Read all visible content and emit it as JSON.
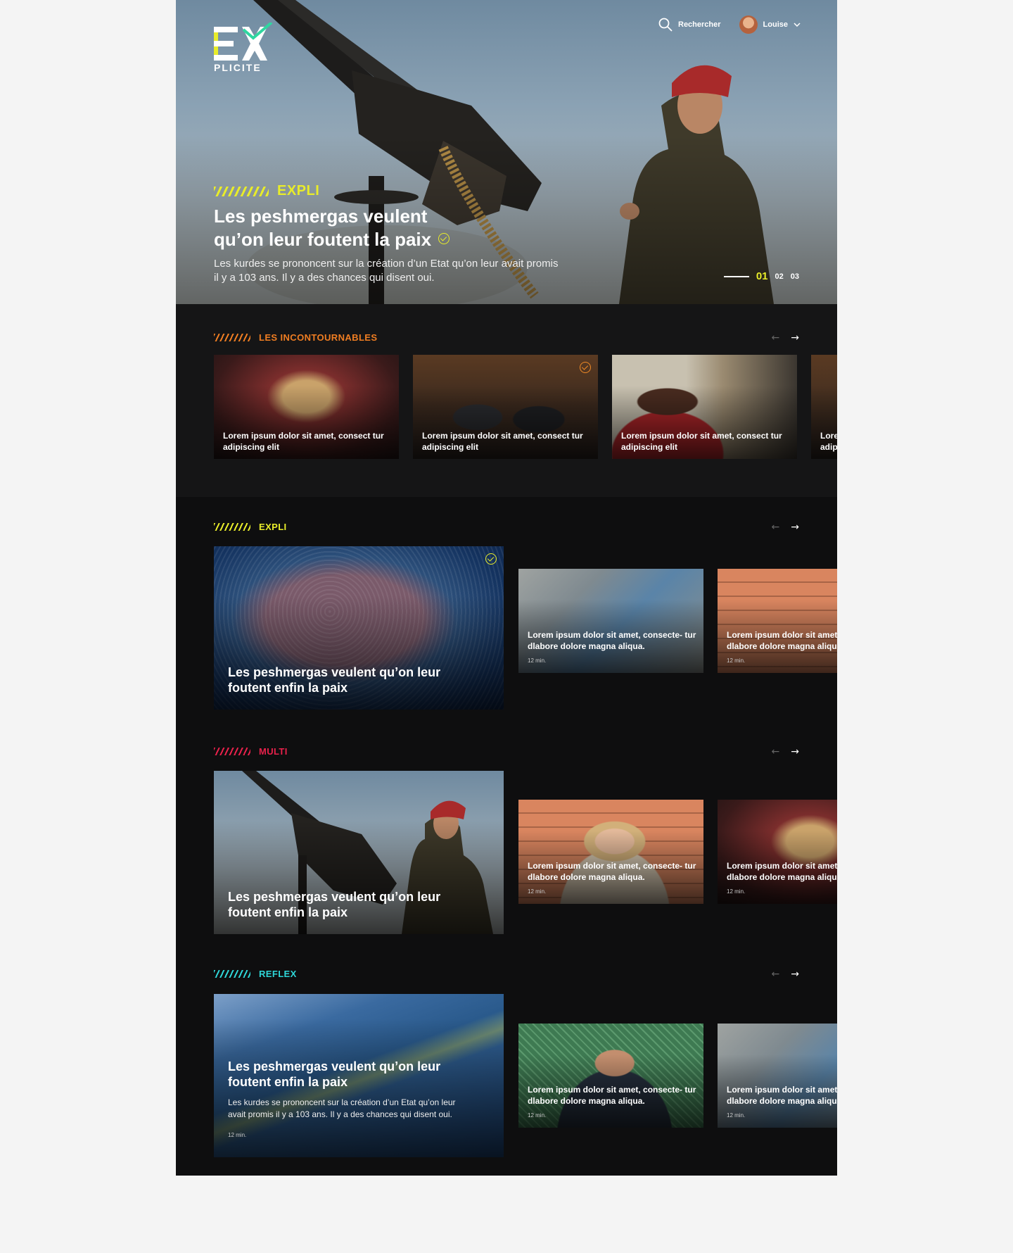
{
  "header": {
    "brand_top": "EX",
    "brand_bottom": "PLICITE",
    "search_label": "Rechercher",
    "user_name": "Louise"
  },
  "hero": {
    "tag": "EXPLI",
    "title_line1": "Les peshmergas veulent",
    "title_line2": "qu’on leur foutent la paix",
    "description": "Les kurdes se prononcent sur la création d’un Etat qu’on leur avait promis il y a 103 ans. Il y a des chances qui disent oui.",
    "pager": [
      "01",
      "02",
      "03"
    ],
    "pager_active": 0
  },
  "colors": {
    "expli": "#e8ec2a",
    "incontournables": "#ef7d22",
    "multi": "#e8214b",
    "reflex": "#2fd6d8"
  },
  "sections": {
    "incontournables": {
      "label": "LES INCONTOURNABLES",
      "cards": [
        {
          "caption": "Lorem ipsum dolor sit amet, consect tur adipiscing elit"
        },
        {
          "caption": "Lorem ipsum dolor sit amet, consect tur adipiscing elit"
        },
        {
          "caption": "Lorem ipsum dolor sit amet, consect tur adipiscing elit"
        },
        {
          "caption": "Lorem ipsum dolor sit amet, consect tur adipiscing elit"
        }
      ]
    },
    "expli": {
      "label": "EXPLI",
      "feature_title": "Les peshmergas veulent qu’on leur foutent enfin la paix",
      "cards": [
        {
          "caption": "Lorem ipsum dolor sit amet, consecte- tur dlabore dolore magna aliqua.",
          "duration": "12 min."
        },
        {
          "caption": "Lorem ipsum dolor sit amet, consecte- tur dlabore dolore magna aliqua.",
          "duration": "12 min."
        }
      ]
    },
    "multi": {
      "label": "MULTI",
      "feature_title": "Les peshmergas veulent qu’on leur foutent enfin la paix",
      "cards": [
        {
          "caption": "Lorem ipsum dolor sit amet, consecte- tur dlabore dolore magna aliqua.",
          "duration": "12 min."
        },
        {
          "caption": "Lorem ipsum dolor sit amet, consecte- tur dlabore dolore magna aliqua.",
          "duration": "12 min."
        }
      ]
    },
    "reflex": {
      "label": "REFLEX",
      "feature_title": "Les peshmergas veulent qu’on leur foutent enfin la paix",
      "feature_desc": "Les kurdes se prononcent sur la création d’un Etat qu’on leur avait promis il y a 103 ans. Il y a des chances qui disent oui.",
      "feature_duration": "12 min.",
      "cards": [
        {
          "caption": "Lorem ipsum dolor sit amet, consecte- tur dlabore dolore magna aliqua.",
          "duration": "12 min."
        },
        {
          "caption": "Lorem ipsum dolor sit amet, consecte- tur dlabore dolore magna aliqua.",
          "duration": "12 min."
        }
      ]
    }
  },
  "nav": {
    "prev_icon": "arrow-left-icon",
    "next_icon": "arrow-right-icon"
  }
}
